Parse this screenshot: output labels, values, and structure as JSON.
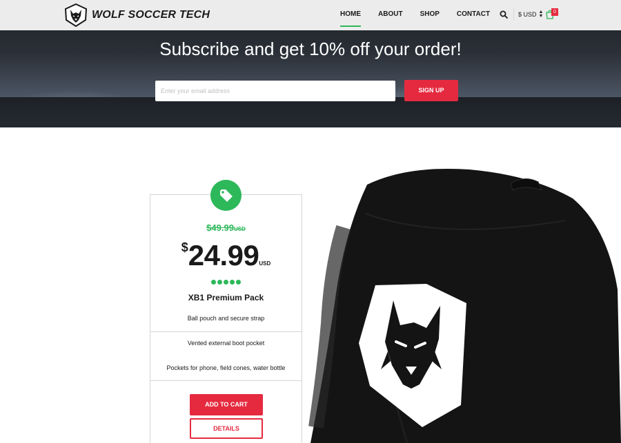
{
  "header": {
    "brand": "WOLF SOCCER TECH",
    "nav": [
      {
        "label": "HOME",
        "active": true
      },
      {
        "label": "ABOUT",
        "active": false
      },
      {
        "label": "SHOP",
        "active": false
      },
      {
        "label": "CONTACT",
        "active": false
      }
    ],
    "currency": "$ USD",
    "cart_count": "0",
    "icons": [
      "wolf-logo-icon",
      "search-icon",
      "currency-arrows-icon",
      "cart-icon"
    ]
  },
  "hero": {
    "title": "Subscribe and get 10% off your order!",
    "email_placeholder": "Enter your email address",
    "signup_label": "SIGN UP"
  },
  "product": {
    "old_price": "$49.99",
    "old_price_currency": "USD",
    "price_symbol": "$",
    "price": "24.99",
    "price_currency": "USD",
    "rating_dots": 5,
    "name": "XB1 Premium Pack",
    "features": [
      "Ball pouch and secure strap",
      "Vented external boot pocket",
      "Pockets for phone, field cones, water bottle"
    ],
    "add_to_cart_label": "ADD TO CART",
    "details_label": "DETAILS"
  },
  "colors": {
    "accent_green": "#2db85a",
    "accent_red": "#e52a3f",
    "header_bg": "#ececec"
  }
}
